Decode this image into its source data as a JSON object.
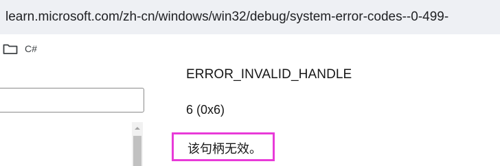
{
  "browser": {
    "url": "learn.microsoft.com/zh-cn/windows/win32/debug/system-error-codes--0-499-"
  },
  "bookmarks": {
    "folder_label": "C#",
    "folder_icon": "folder-icon"
  },
  "sidebar": {
    "search_value": ""
  },
  "content": {
    "error_name": "ERROR_INVALID_HANDLE",
    "error_code": "6 (0x6)",
    "error_description": "该句柄无效。"
  },
  "colors": {
    "url_bar_bg": "#eef0f4",
    "highlight_border": "#e83ad8"
  }
}
